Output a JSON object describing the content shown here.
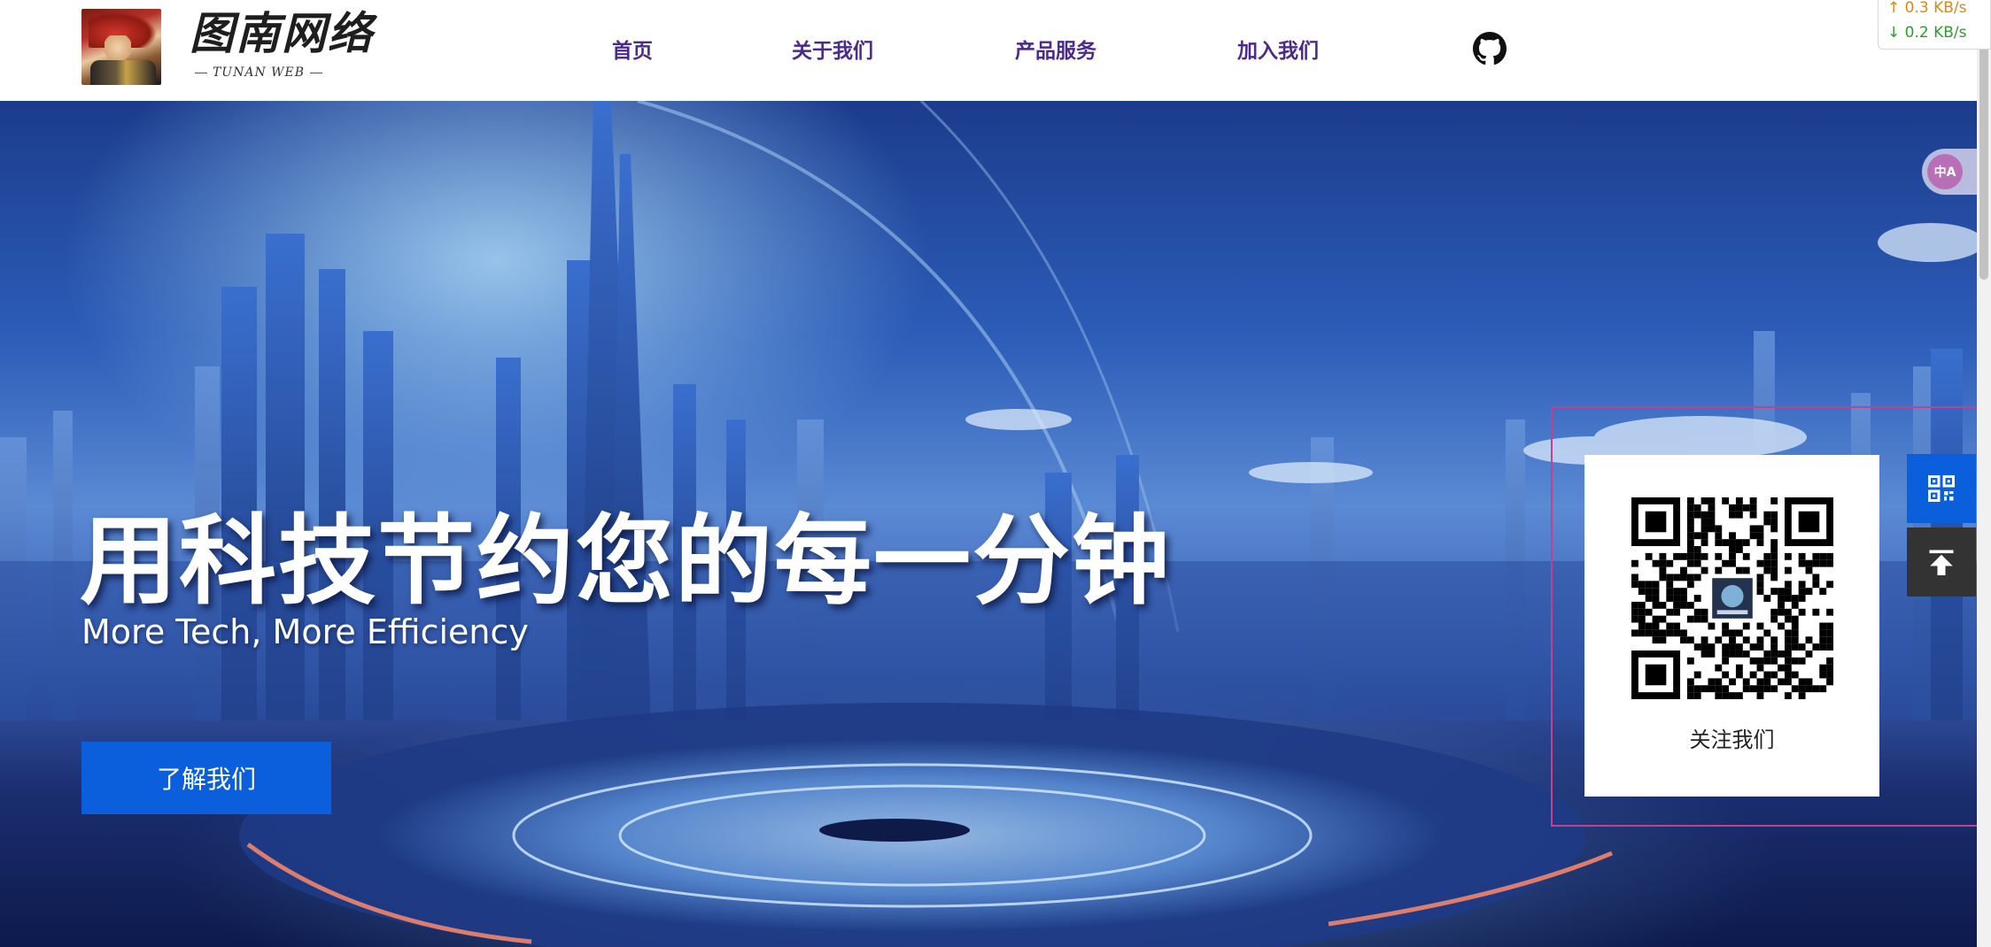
{
  "header": {
    "logo_title": "图南网络",
    "logo_subtitle": "TUNAN WEB",
    "nav": [
      {
        "label": "首页"
      },
      {
        "label": "关于我们"
      },
      {
        "label": "产品服务"
      },
      {
        "label": "加入我们"
      }
    ],
    "github_icon": "github-icon"
  },
  "netspeed": {
    "upload": "↑ 0.3 KB/s",
    "download": "↓ 0.2 KB/s"
  },
  "hero": {
    "headline": "用科技节约您的每一分钟",
    "subtitle": "More Tech, More Efficiency",
    "button_label": "了解我们"
  },
  "qr_popup": {
    "caption": "关注我们"
  },
  "side_tools": {
    "qr_icon": "qrcode-icon",
    "top_icon": "back-to-top-icon",
    "translate_label": "中A"
  },
  "colors": {
    "nav_text": "#4b2a8c",
    "button_blue": "#0b5fdc",
    "side_dark": "#333333",
    "highlight_border": "#c0428f"
  }
}
